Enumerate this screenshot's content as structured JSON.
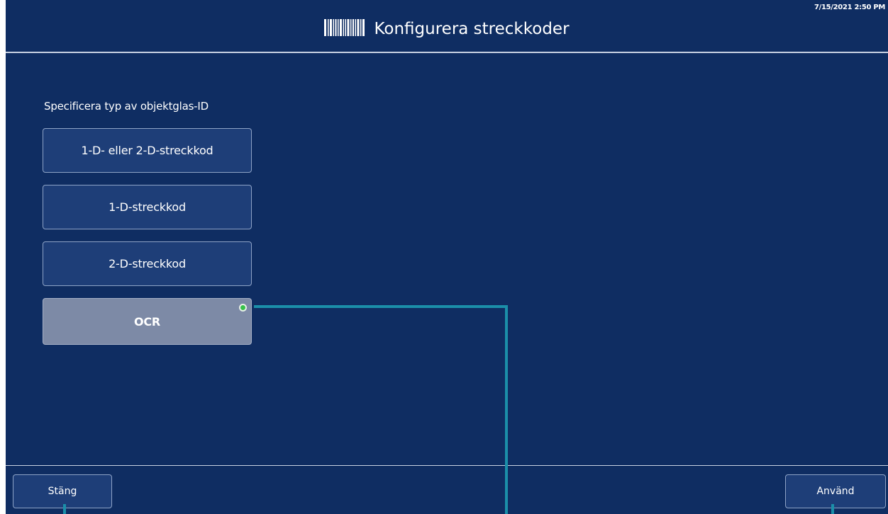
{
  "header": {
    "title": "Konfigurera streckkoder",
    "icon": "barcode-icon",
    "timestamp": "7/15/2021 2:50 PM"
  },
  "main": {
    "section_label": "Specificera typ av objektglas-ID",
    "options": [
      {
        "label": "1-D- eller 2-D-streckkod",
        "selected": false
      },
      {
        "label": "1-D-streckkod",
        "selected": false
      },
      {
        "label": "2-D-streckkod",
        "selected": false
      },
      {
        "label": "OCR",
        "selected": true
      }
    ]
  },
  "footer": {
    "close_label": "Stäng",
    "apply_label": "Använd"
  },
  "colors": {
    "background": "#0f2d62",
    "button": "#1e3e78",
    "selected_button": "#7d8aa6",
    "selected_indicator": "#37c24a",
    "callout": "#1b8fa9"
  }
}
